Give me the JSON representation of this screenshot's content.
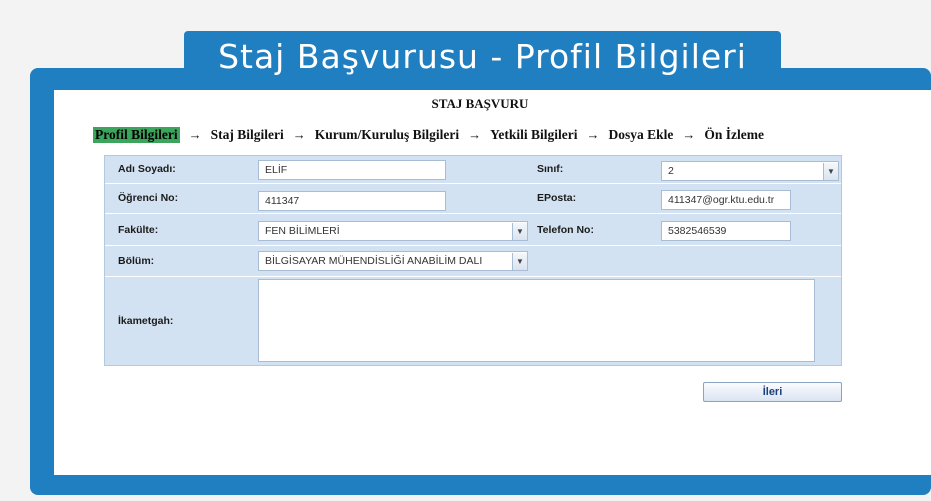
{
  "banner_title": "Staj Başvurusu - Profil Bilgileri",
  "page_title": "STAJ BAŞVURU",
  "steps": [
    {
      "label": "Profil Bilgileri",
      "active": true
    },
    {
      "label": "Staj Bilgileri"
    },
    {
      "label": "Kurum/Kuruluş Bilgileri"
    },
    {
      "label": "Yetkili Bilgileri"
    },
    {
      "label": "Dosya Ekle"
    },
    {
      "label": "Ön İzleme"
    }
  ],
  "arrow_glyph": "→",
  "form": {
    "name_label": "Adı Soyadı:",
    "name_value": "ELİF",
    "class_label": "Sınıf:",
    "class_value": "2",
    "student_no_label": "Öğrenci No:",
    "student_no_value": "411347",
    "email_label": "EPosta:",
    "email_value": "411347@ogr.ktu.edu.tr",
    "faculty_label": "Fakülte:",
    "faculty_value": "FEN BİLİMLERİ",
    "phone_label": "Telefon No:",
    "phone_value": "5382546539",
    "department_label": "Bölüm:",
    "department_value": "BİLGİSAYAR MÜHENDİSLİĞİ ANABİLİM DALI",
    "residence_label": "İkametgah:",
    "residence_value": ""
  },
  "next_button": "İleri",
  "colors": {
    "brand_blue": "#1f7fc0",
    "active_step": "#3ba55c",
    "form_bg": "#d3e2f2"
  }
}
